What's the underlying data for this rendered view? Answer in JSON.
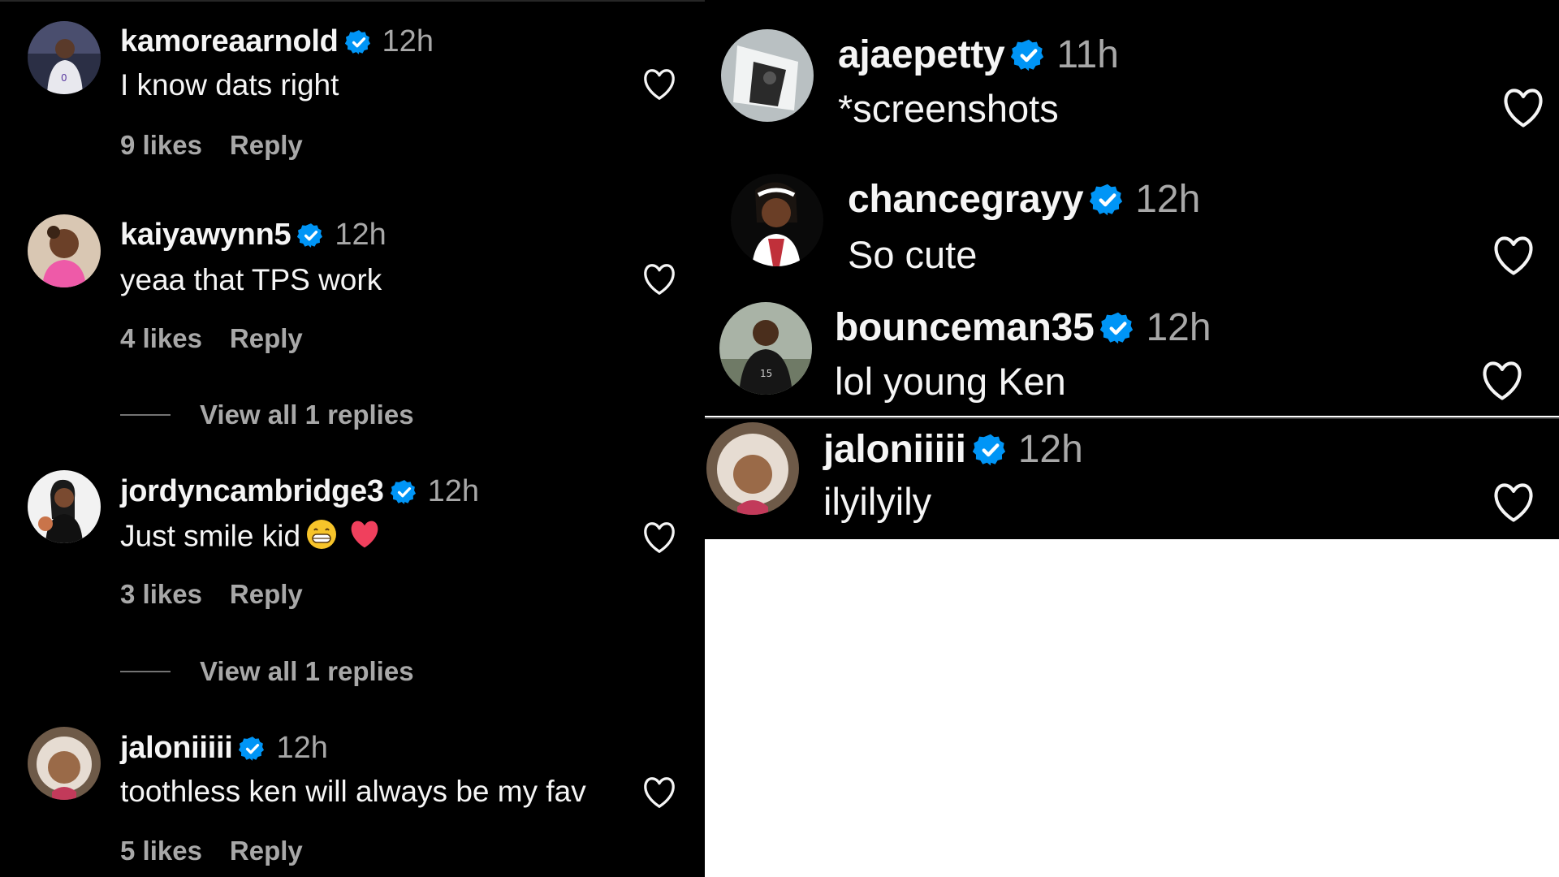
{
  "left_comments": [
    {
      "username": "kamoreaarnold",
      "time": "12h",
      "text": "I know dats right",
      "likes": "9 likes",
      "reply": "Reply"
    },
    {
      "username": "kaiyawynn5",
      "time": "12h",
      "text": "yeaa that TPS work",
      "likes": "4 likes",
      "reply": "Reply",
      "view_replies": "View all 1 replies"
    },
    {
      "username": "jordyncambridge3",
      "time": "12h",
      "text": "Just smile kid",
      "emojis": [
        "grinning-face-emoji",
        "red-heart-emoji"
      ],
      "likes": "3 likes",
      "reply": "Reply",
      "view_replies": "View all 1 replies"
    },
    {
      "username": "jaloniiiii",
      "time": "12h",
      "text": "toothless ken will always be my fav",
      "likes": "5 likes",
      "reply": "Reply"
    }
  ],
  "right_comments": [
    {
      "username": "ajaepetty",
      "time": "11h",
      "text": "*screenshots"
    },
    {
      "username": "chancegrayy",
      "time": "12h",
      "text": "So cute"
    },
    {
      "username": "bounceman35",
      "time": "12h",
      "text": "lol young Ken"
    },
    {
      "username": "jaloniiiii",
      "time": "12h",
      "text": "ilyilyily"
    }
  ],
  "icons": {
    "verified": "verified-badge-icon",
    "like": "heart-outline-icon"
  },
  "colors": {
    "background": "#000000",
    "text": "#f5f5f5",
    "secondary": "#a8a8a8",
    "verified_blue": "#0095f6"
  }
}
